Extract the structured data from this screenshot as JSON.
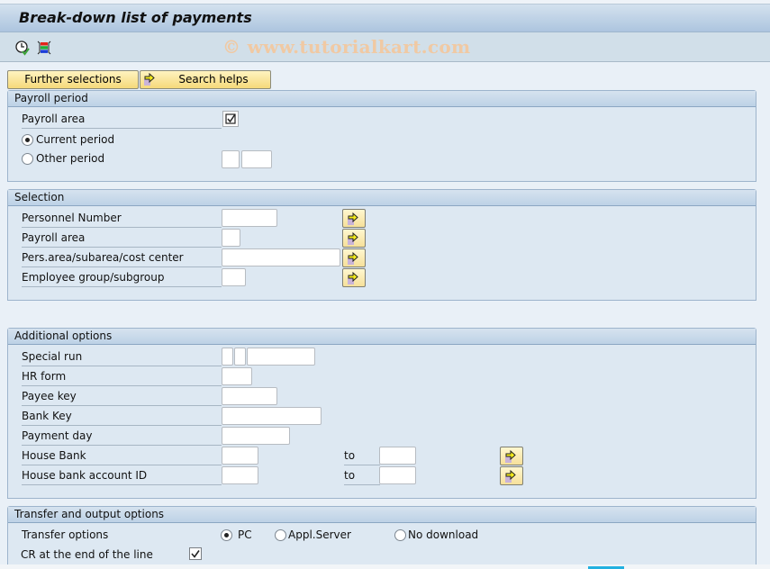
{
  "window": {
    "title": "Break-down list of payments"
  },
  "toolbar": {
    "watermark": "© www.tutorialkart.com",
    "icons": [
      "execute-clock-icon",
      "selection-options-icon"
    ]
  },
  "buttons": {
    "further_selections": "Further selections",
    "search_helps": "Search helps"
  },
  "payroll_period": {
    "header": "Payroll period",
    "payroll_area_label": "Payroll area",
    "payroll_area_checked": true,
    "current_period_label": "Current period",
    "other_period_label": "Other period",
    "selected": "current_period",
    "other_period_value1": "",
    "other_period_value2": ""
  },
  "selection": {
    "header": "Selection",
    "fields": [
      {
        "label": "Personnel Number",
        "value": ""
      },
      {
        "label": "Payroll area",
        "value": ""
      },
      {
        "label": "Pers.area/subarea/cost center",
        "value": ""
      },
      {
        "label": "Employee group/subgroup",
        "value": ""
      }
    ]
  },
  "additional_options": {
    "header": "Additional options",
    "fields": [
      {
        "label": "Special run",
        "value": ""
      },
      {
        "label": "HR form",
        "value": ""
      },
      {
        "label": "Payee key",
        "value": ""
      },
      {
        "label": "Bank Key",
        "value": ""
      },
      {
        "label": "Payment day",
        "value": ""
      },
      {
        "label": "House Bank",
        "value": "",
        "to_label": "to",
        "to_value": ""
      },
      {
        "label": "House bank account ID",
        "value": "",
        "to_label": "to",
        "to_value": ""
      }
    ]
  },
  "transfer_output": {
    "header": "Transfer and output options",
    "transfer_options_label": "Transfer options",
    "options": [
      {
        "label": "PC",
        "selected": true
      },
      {
        "label": "Appl.Server",
        "selected": false
      },
      {
        "label": "No download",
        "selected": false
      }
    ],
    "cr_label": "CR at the end of the line",
    "cr_checked": true
  }
}
